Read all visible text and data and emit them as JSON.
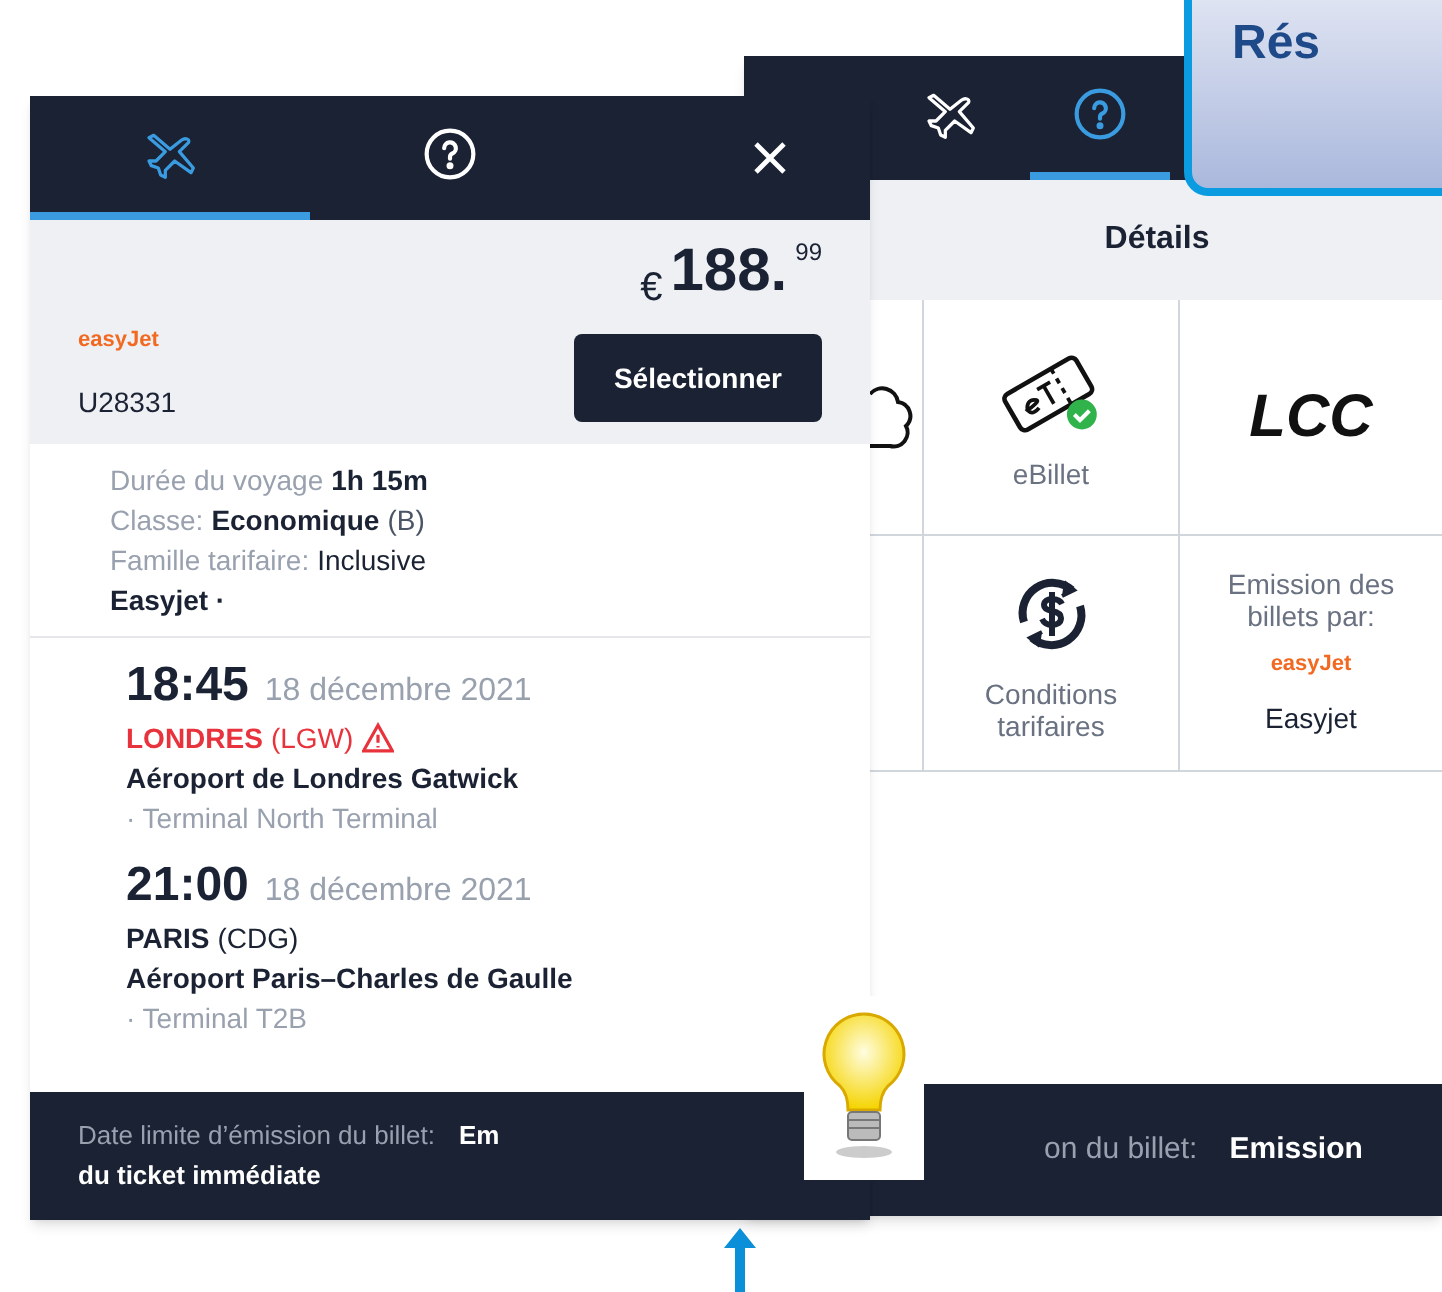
{
  "callout": {
    "text": "Rés"
  },
  "front": {
    "tabs": [
      {
        "selected": true
      },
      {
        "selected": false
      }
    ],
    "price": {
      "currency": "€",
      "whole": "188.",
      "cents": "99"
    },
    "airline_logo": "easyJet",
    "flight_number": "U28331",
    "select_button": "Sélectionner",
    "details": [
      {
        "label": "Durée du voyage",
        "value": "1h 15m",
        "bold": true
      },
      {
        "label": "Classe:",
        "value": "Economique",
        "note": "(B)",
        "bold": true
      },
      {
        "label": "Famille tarifaire:",
        "value": "Inclusive",
        "bold": false
      },
      {
        "value": "Easyjet ·",
        "bold": true
      }
    ],
    "segments": [
      {
        "time": "18:45",
        "date": "18 décembre 2021",
        "city": "LONDRES",
        "code": "(LGW)",
        "warning": true,
        "airport": "Aéroport de Londres Gatwick",
        "terminal": "· Terminal North Terminal"
      },
      {
        "time": "21:00",
        "date": "18 décembre 2021",
        "city": "PARIS",
        "code": "(CDG)",
        "warning": false,
        "airport": "Aéroport Paris–Charles de Gaulle",
        "terminal": "· Terminal T2B"
      }
    ],
    "footer": {
      "label": "Date limite d’émission du billet:",
      "value_start": "Em",
      "value_end": "du ticket immédiate"
    }
  },
  "back": {
    "tabs": [
      {
        "selected": false
      },
      {
        "selected": true
      }
    ],
    "title": "Détails",
    "cells": [
      {
        "kind": "cloud"
      },
      {
        "kind": "ticket",
        "label": "eBillet"
      },
      {
        "kind": "text",
        "text": "LCC"
      },
      {
        "kind": "empty"
      },
      {
        "kind": "dollar",
        "label": "Conditions tarifaires"
      },
      {
        "kind": "issuer",
        "label": "Emission des billets par:",
        "logo": "easyJet",
        "name": "Easyjet"
      }
    ],
    "footer": {
      "label": "on du billet:",
      "value": "Emission"
    }
  }
}
